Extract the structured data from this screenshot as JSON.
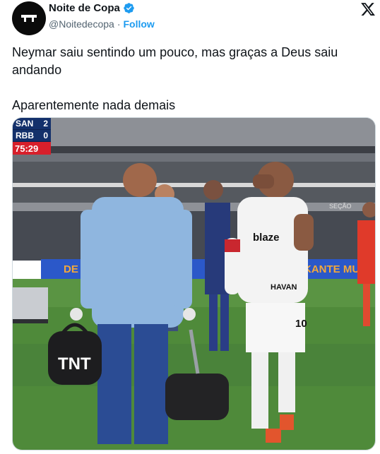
{
  "account": {
    "display_name": "Noite de Copa",
    "handle": "@Noitedecopa",
    "separator": "·",
    "follow_label": "Follow",
    "avatar_icon": "noite-de-copa-logo-icon",
    "verified_icon": "verified-badge-icon",
    "platform_icon": "x-logo-icon"
  },
  "tweet": {
    "line1": "Neymar saiu sentindo um pouco, mas graças a Deus saiu andando",
    "line2": "Aparentemente nada demais"
  },
  "media": {
    "scoreboard": {
      "team1": "SAN",
      "score1": "2",
      "team2": "RBB",
      "score2": "0",
      "clock": "75:29"
    },
    "bag_text": "TNT",
    "shirt_sponsor": "blaze",
    "shirt_number": "10",
    "shirt_lower_text": "HAVAN",
    "board_left": "DE",
    "board_right": "KANTE MUS",
    "stadium_sign": "SEÇÃO"
  },
  "colors": {
    "accent": "#1d9bf0",
    "text": "#0f1419",
    "secondary_text": "#536471"
  }
}
